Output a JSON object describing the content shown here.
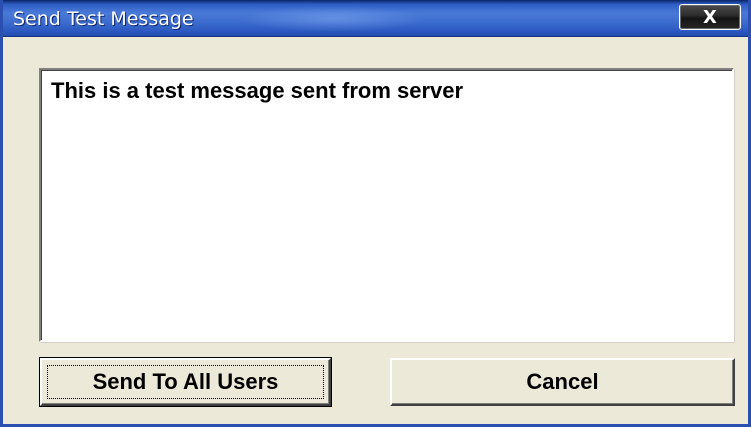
{
  "window": {
    "title": "Send Test Message",
    "close_label": "X"
  },
  "message": {
    "value": "This is a test message sent from server"
  },
  "buttons": {
    "send_label": "Send To All Users",
    "cancel_label": "Cancel"
  },
  "colors": {
    "titlebar": "#2f5ec4",
    "dialog_background": "#ece9d8",
    "textbox_background": "#ffffff"
  }
}
